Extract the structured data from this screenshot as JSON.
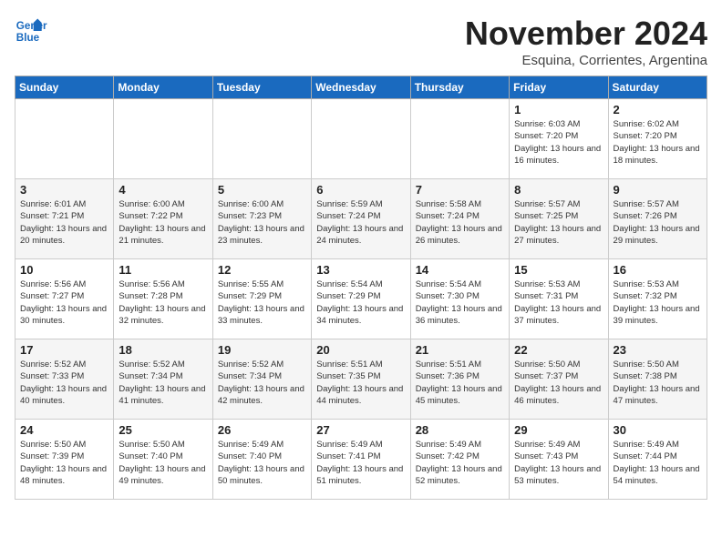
{
  "logo": {
    "line1": "General",
    "line2": "Blue"
  },
  "title": "November 2024",
  "subtitle": "Esquina, Corrientes, Argentina",
  "days_of_week": [
    "Sunday",
    "Monday",
    "Tuesday",
    "Wednesday",
    "Thursday",
    "Friday",
    "Saturday"
  ],
  "weeks": [
    [
      {
        "day": "",
        "info": ""
      },
      {
        "day": "",
        "info": ""
      },
      {
        "day": "",
        "info": ""
      },
      {
        "day": "",
        "info": ""
      },
      {
        "day": "",
        "info": ""
      },
      {
        "day": "1",
        "info": "Sunrise: 6:03 AM\nSunset: 7:20 PM\nDaylight: 13 hours\nand 16 minutes."
      },
      {
        "day": "2",
        "info": "Sunrise: 6:02 AM\nSunset: 7:20 PM\nDaylight: 13 hours\nand 18 minutes."
      }
    ],
    [
      {
        "day": "3",
        "info": "Sunrise: 6:01 AM\nSunset: 7:21 PM\nDaylight: 13 hours\nand 20 minutes."
      },
      {
        "day": "4",
        "info": "Sunrise: 6:00 AM\nSunset: 7:22 PM\nDaylight: 13 hours\nand 21 minutes."
      },
      {
        "day": "5",
        "info": "Sunrise: 6:00 AM\nSunset: 7:23 PM\nDaylight: 13 hours\nand 23 minutes."
      },
      {
        "day": "6",
        "info": "Sunrise: 5:59 AM\nSunset: 7:24 PM\nDaylight: 13 hours\nand 24 minutes."
      },
      {
        "day": "7",
        "info": "Sunrise: 5:58 AM\nSunset: 7:24 PM\nDaylight: 13 hours\nand 26 minutes."
      },
      {
        "day": "8",
        "info": "Sunrise: 5:57 AM\nSunset: 7:25 PM\nDaylight: 13 hours\nand 27 minutes."
      },
      {
        "day": "9",
        "info": "Sunrise: 5:57 AM\nSunset: 7:26 PM\nDaylight: 13 hours\nand 29 minutes."
      }
    ],
    [
      {
        "day": "10",
        "info": "Sunrise: 5:56 AM\nSunset: 7:27 PM\nDaylight: 13 hours\nand 30 minutes."
      },
      {
        "day": "11",
        "info": "Sunrise: 5:56 AM\nSunset: 7:28 PM\nDaylight: 13 hours\nand 32 minutes."
      },
      {
        "day": "12",
        "info": "Sunrise: 5:55 AM\nSunset: 7:29 PM\nDaylight: 13 hours\nand 33 minutes."
      },
      {
        "day": "13",
        "info": "Sunrise: 5:54 AM\nSunset: 7:29 PM\nDaylight: 13 hours\nand 34 minutes."
      },
      {
        "day": "14",
        "info": "Sunrise: 5:54 AM\nSunset: 7:30 PM\nDaylight: 13 hours\nand 36 minutes."
      },
      {
        "day": "15",
        "info": "Sunrise: 5:53 AM\nSunset: 7:31 PM\nDaylight: 13 hours\nand 37 minutes."
      },
      {
        "day": "16",
        "info": "Sunrise: 5:53 AM\nSunset: 7:32 PM\nDaylight: 13 hours\nand 39 minutes."
      }
    ],
    [
      {
        "day": "17",
        "info": "Sunrise: 5:52 AM\nSunset: 7:33 PM\nDaylight: 13 hours\nand 40 minutes."
      },
      {
        "day": "18",
        "info": "Sunrise: 5:52 AM\nSunset: 7:34 PM\nDaylight: 13 hours\nand 41 minutes."
      },
      {
        "day": "19",
        "info": "Sunrise: 5:52 AM\nSunset: 7:34 PM\nDaylight: 13 hours\nand 42 minutes."
      },
      {
        "day": "20",
        "info": "Sunrise: 5:51 AM\nSunset: 7:35 PM\nDaylight: 13 hours\nand 44 minutes."
      },
      {
        "day": "21",
        "info": "Sunrise: 5:51 AM\nSunset: 7:36 PM\nDaylight: 13 hours\nand 45 minutes."
      },
      {
        "day": "22",
        "info": "Sunrise: 5:50 AM\nSunset: 7:37 PM\nDaylight: 13 hours\nand 46 minutes."
      },
      {
        "day": "23",
        "info": "Sunrise: 5:50 AM\nSunset: 7:38 PM\nDaylight: 13 hours\nand 47 minutes."
      }
    ],
    [
      {
        "day": "24",
        "info": "Sunrise: 5:50 AM\nSunset: 7:39 PM\nDaylight: 13 hours\nand 48 minutes."
      },
      {
        "day": "25",
        "info": "Sunrise: 5:50 AM\nSunset: 7:40 PM\nDaylight: 13 hours\nand 49 minutes."
      },
      {
        "day": "26",
        "info": "Sunrise: 5:49 AM\nSunset: 7:40 PM\nDaylight: 13 hours\nand 50 minutes."
      },
      {
        "day": "27",
        "info": "Sunrise: 5:49 AM\nSunset: 7:41 PM\nDaylight: 13 hours\nand 51 minutes."
      },
      {
        "day": "28",
        "info": "Sunrise: 5:49 AM\nSunset: 7:42 PM\nDaylight: 13 hours\nand 52 minutes."
      },
      {
        "day": "29",
        "info": "Sunrise: 5:49 AM\nSunset: 7:43 PM\nDaylight: 13 hours\nand 53 minutes."
      },
      {
        "day": "30",
        "info": "Sunrise: 5:49 AM\nSunset: 7:44 PM\nDaylight: 13 hours\nand 54 minutes."
      }
    ]
  ]
}
